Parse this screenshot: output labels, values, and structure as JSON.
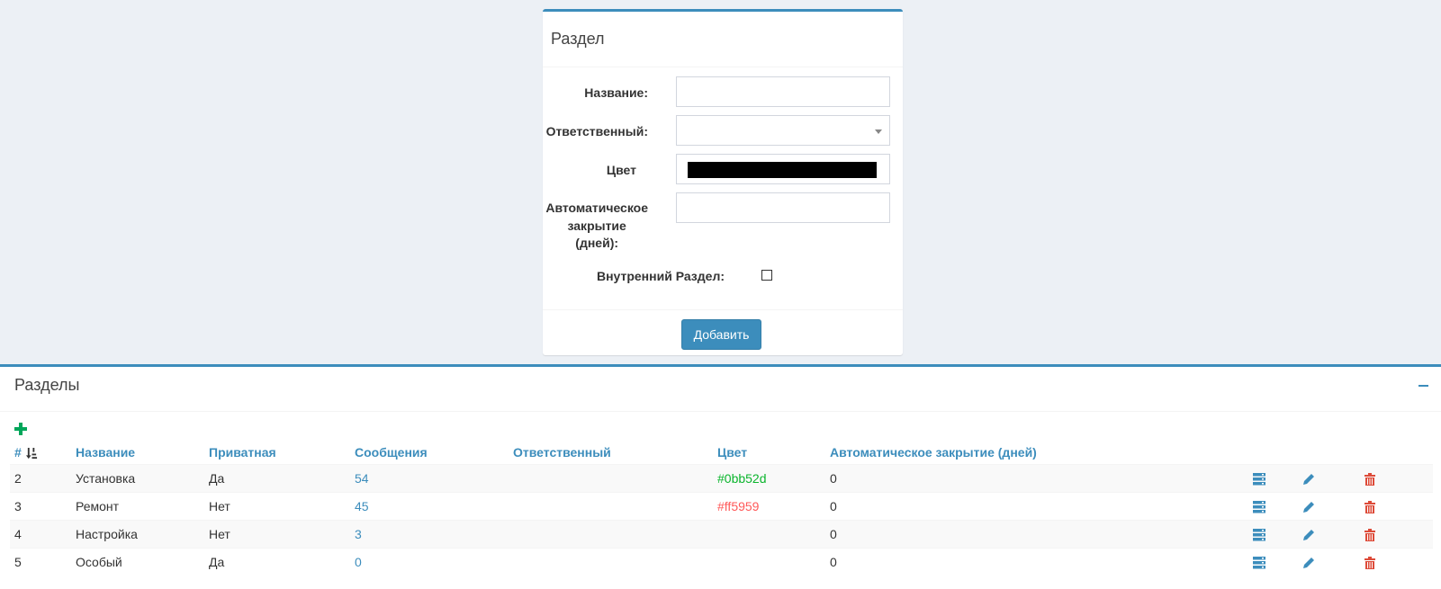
{
  "form": {
    "title": "Раздел",
    "name_label": "Название:",
    "name_value": "",
    "responsible_label": "Ответственный:",
    "responsible_value": "",
    "color_label": "Цвет",
    "color_value": "#000000",
    "autoclose_label_line1": "Автоматическое",
    "autoclose_label_line2": "закрытие",
    "autoclose_label_line3": "(дней):",
    "autoclose_value": "",
    "internal_label": "Внутренний Раздел:",
    "internal_checked": false,
    "submit_label": "Добавить"
  },
  "list": {
    "title": "Разделы",
    "columns": {
      "num": "#",
      "name": "Название",
      "private": "Приватная",
      "messages": "Сообщения",
      "responsible": "Ответственный",
      "color": "Цвет",
      "autoclose": "Автоматическое закрытие (дней)"
    },
    "rows": [
      {
        "id": "2",
        "name": "Установка",
        "private": "Да",
        "messages": "54",
        "responsible": "",
        "color": "#0bb52d",
        "autoclose": "0"
      },
      {
        "id": "3",
        "name": "Ремонт",
        "private": "Нет",
        "messages": "45",
        "responsible": "",
        "color": "#ff5959",
        "autoclose": "0"
      },
      {
        "id": "4",
        "name": "Настройка",
        "private": "Нет",
        "messages": "3",
        "responsible": "",
        "color": "",
        "autoclose": "0"
      },
      {
        "id": "5",
        "name": "Особый",
        "private": "Да",
        "messages": "0",
        "responsible": "",
        "color": "",
        "autoclose": "0"
      }
    ]
  },
  "icons": {
    "add": "plus-icon",
    "sort": "sort-numeric-icon",
    "list": "list-icon",
    "edit": "pencil-icon",
    "delete": "trash-icon",
    "collapse": "minus-icon"
  },
  "colors": {
    "primary": "#3c8dbc",
    "add_green": "#00a65a",
    "delete_red": "#dd4b39"
  }
}
